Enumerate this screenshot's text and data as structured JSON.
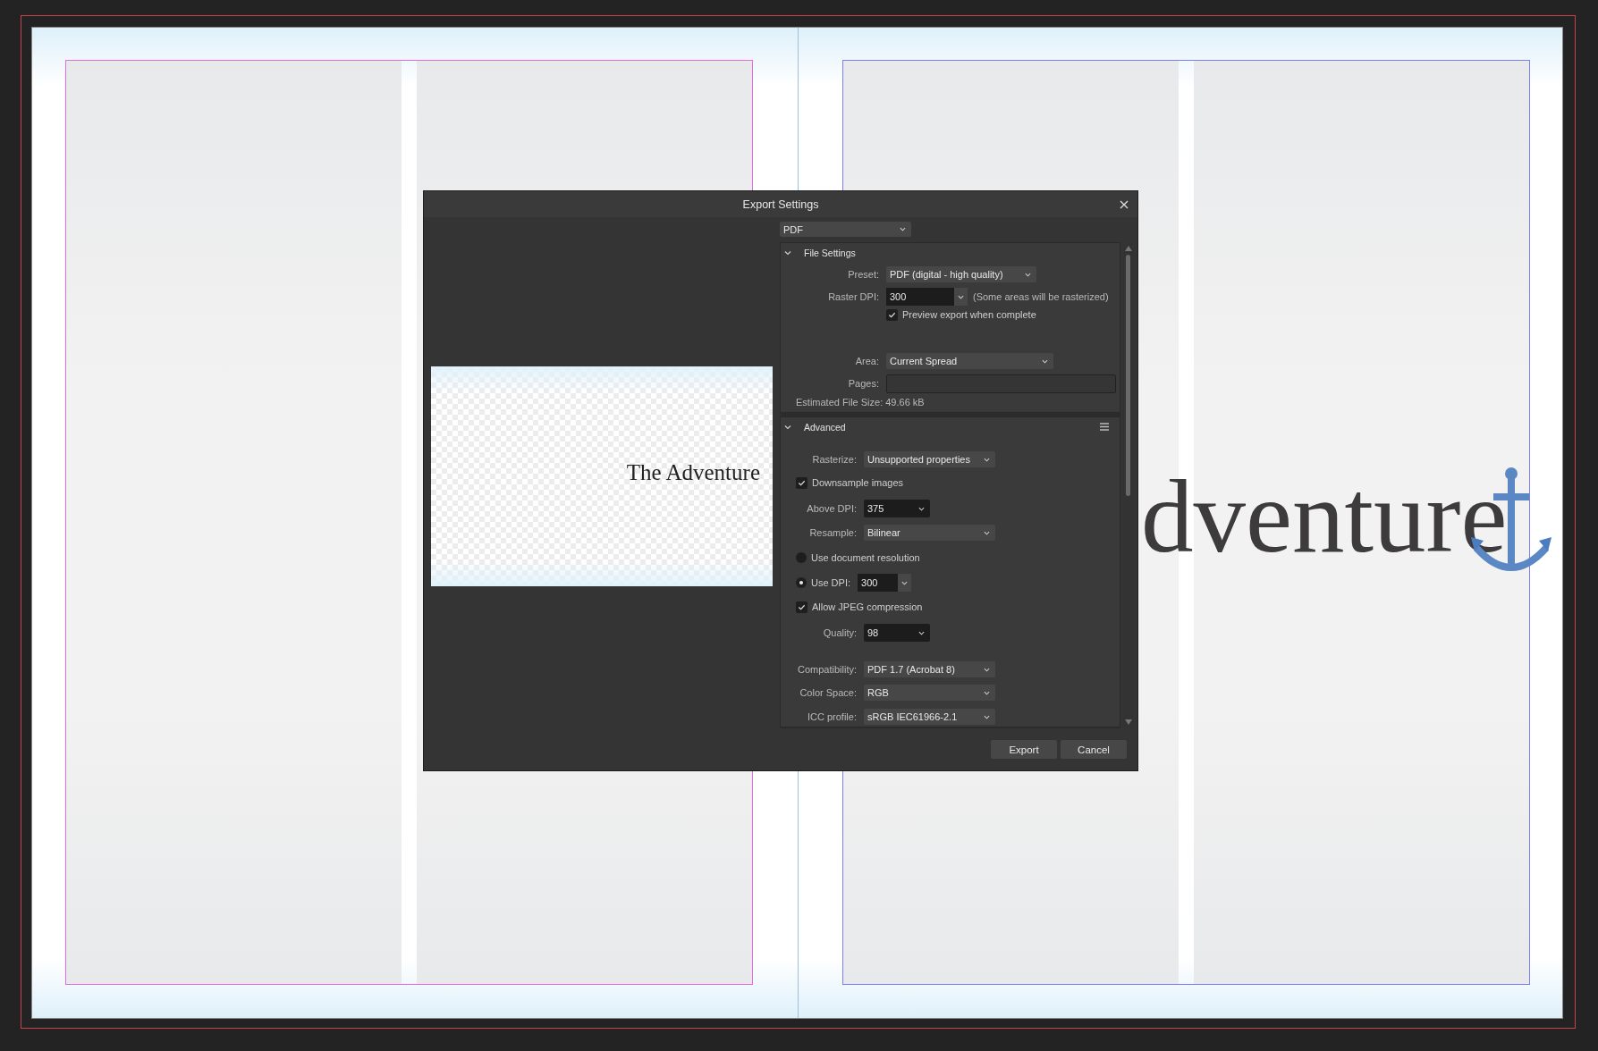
{
  "canvas": {
    "heading_visible": "dventure"
  },
  "dialog": {
    "title": "Export Settings",
    "format": {
      "value": "PDF"
    },
    "preview": {
      "text": "The Adventure"
    },
    "sections": [
      {
        "title": "File Settings",
        "expanded": true,
        "menu": false,
        "rows": [
          {
            "kind": "select",
            "label": "Preset:",
            "value": "PDF (digital - high quality)"
          },
          {
            "kind": "combo",
            "label": "Raster DPI:",
            "value": "300",
            "note": "(Some areas will be rasterized)"
          },
          {
            "kind": "checkbox",
            "label": "Preview export when complete",
            "checked": true
          },
          {
            "kind": "select",
            "label": "Area:",
            "value": "Current Spread"
          },
          {
            "kind": "field",
            "label": "Pages:"
          },
          {
            "kind": "text",
            "text": "Estimated File Size: 49.66 kB"
          }
        ]
      },
      {
        "title": "Advanced",
        "expanded": true,
        "menu": true,
        "rows": [
          {
            "kind": "select",
            "label": "Rasterize:",
            "value": "Unsupported properties"
          },
          {
            "kind": "checkbox",
            "label": "Downsample images",
            "checked": true
          },
          {
            "kind": "dark-select",
            "label": "Above DPI:",
            "value": "375"
          },
          {
            "kind": "select",
            "label": "Resample:",
            "value": "Bilinear"
          },
          {
            "kind": "radio",
            "label": "Use document resolution",
            "selected": false
          },
          {
            "kind": "radio-input",
            "label": "Use DPI:",
            "value": "300",
            "selected": true
          },
          {
            "kind": "checkbox",
            "label": "Allow JPEG compression",
            "checked": true
          },
          {
            "kind": "dark-select",
            "label": "Quality:",
            "value": "98"
          },
          {
            "kind": "select",
            "label": "Compatibility:",
            "value": "PDF 1.7 (Acrobat 8)"
          },
          {
            "kind": "select",
            "label": "Color Space:",
            "value": "RGB"
          },
          {
            "kind": "select",
            "label": "ICC profile:",
            "value": "sRGB IEC61966-2.1"
          }
        ]
      }
    ],
    "buttons": [
      {
        "label": "Export"
      },
      {
        "label": "Cancel"
      }
    ]
  }
}
